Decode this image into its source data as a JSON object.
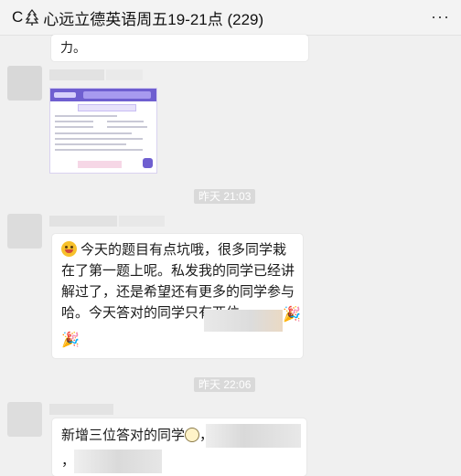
{
  "header": {
    "title_prefix": "C",
    "title_icon": "tree-icon",
    "title_text": "心远立德英语周五19-21点 (229)",
    "more_label": "···"
  },
  "messages": {
    "prev_text_fragment": "力。",
    "image_message": {
      "type": "image",
      "description_icon": "worksheet-thumbnail"
    },
    "time1": "昨天 21:03",
    "text_message_1": {
      "line": "今天的题目有点坑哦，很多同学栽在了第一题上呢。私发我的同学已经讲解过了，还是希望还有更多的同学参与哈。今天答对的同学只有两位",
      "emoji_start": "squinting-tongue-face-icon",
      "emoji_end": "party-popper-icon"
    },
    "time2": "昨天 22:06",
    "text_message_2": {
      "line": "新增三位答对的同学",
      "emoji": "astonished-face-icon",
      "after": "，",
      "line2": "，"
    }
  },
  "colors": {
    "background": "#f0f0f0",
    "bubble": "#ffffff",
    "time_badge": "#d9d9d9",
    "accent_purple": "#6f5fd0"
  }
}
